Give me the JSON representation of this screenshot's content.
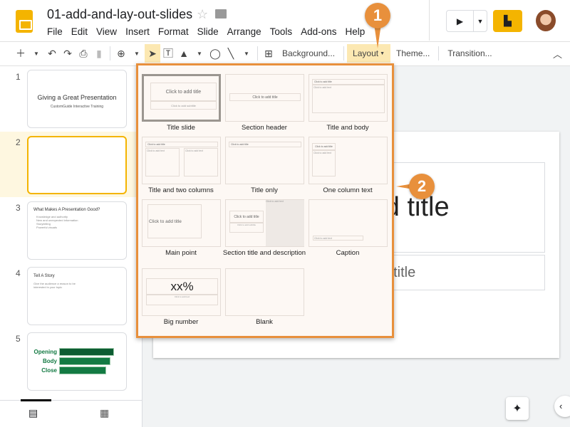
{
  "app": {
    "doc_title": "01-add-and-lay-out-slides",
    "menu": [
      "File",
      "Edit",
      "View",
      "Insert",
      "Format",
      "Slide",
      "Arrange",
      "Tools",
      "Add-ons",
      "Help"
    ]
  },
  "toolbar": {
    "background": "Background...",
    "layout": "Layout",
    "theme": "Theme...",
    "transition": "Transition..."
  },
  "filmstrip": {
    "slides": [
      {
        "num": "1",
        "title": "Giving a Great Presentation",
        "subtitle": "CustomGuide Interactive Training"
      },
      {
        "num": "2"
      },
      {
        "num": "3",
        "title": "What Makes A Presentation Good?",
        "bullets": [
          "Knowledge and authority",
          "New and unexpected information",
          "Storytelling",
          "Powerful visuals"
        ]
      },
      {
        "num": "4",
        "title": "Tell A Story",
        "body": "Give the audience a reason to be interested in your topic"
      },
      {
        "num": "5",
        "labels": [
          "Opening",
          "Body",
          "Close"
        ]
      }
    ]
  },
  "slide": {
    "title": "Click to add title",
    "subtitle": "Click to add subtitle"
  },
  "layout_menu": {
    "items": [
      {
        "label": "Title slide",
        "title": "Click to add title",
        "subtitle": "Click to add subtitle",
        "selected": true
      },
      {
        "label": "Section header",
        "title": "Click to add title"
      },
      {
        "label": "Title and body",
        "title": "Click to add title",
        "body": "Click to add text"
      },
      {
        "label": "Title and two columns",
        "title": "Click to add title",
        "body": "Click to add text"
      },
      {
        "label": "Title only",
        "title": "Click to add title"
      },
      {
        "label": "One column text",
        "title": "Click to add title",
        "body": "Click to add text"
      },
      {
        "label": "Main point",
        "title": "Click to add title"
      },
      {
        "label": "Section title and description",
        "title": "Click to add title",
        "subtitle": "Click to add subtitle",
        "body": "Click to add text"
      },
      {
        "label": "Caption",
        "body": "Click to add text"
      },
      {
        "label": "Big number",
        "title": "xx%",
        "body": "Click to add text"
      },
      {
        "label": "Blank"
      }
    ]
  },
  "callouts": [
    "1",
    "2"
  ],
  "colors": {
    "accent": "#e8903c",
    "brand": "#f4b400",
    "selected_row": "#fef7e0",
    "chart_green": "#137a43"
  }
}
